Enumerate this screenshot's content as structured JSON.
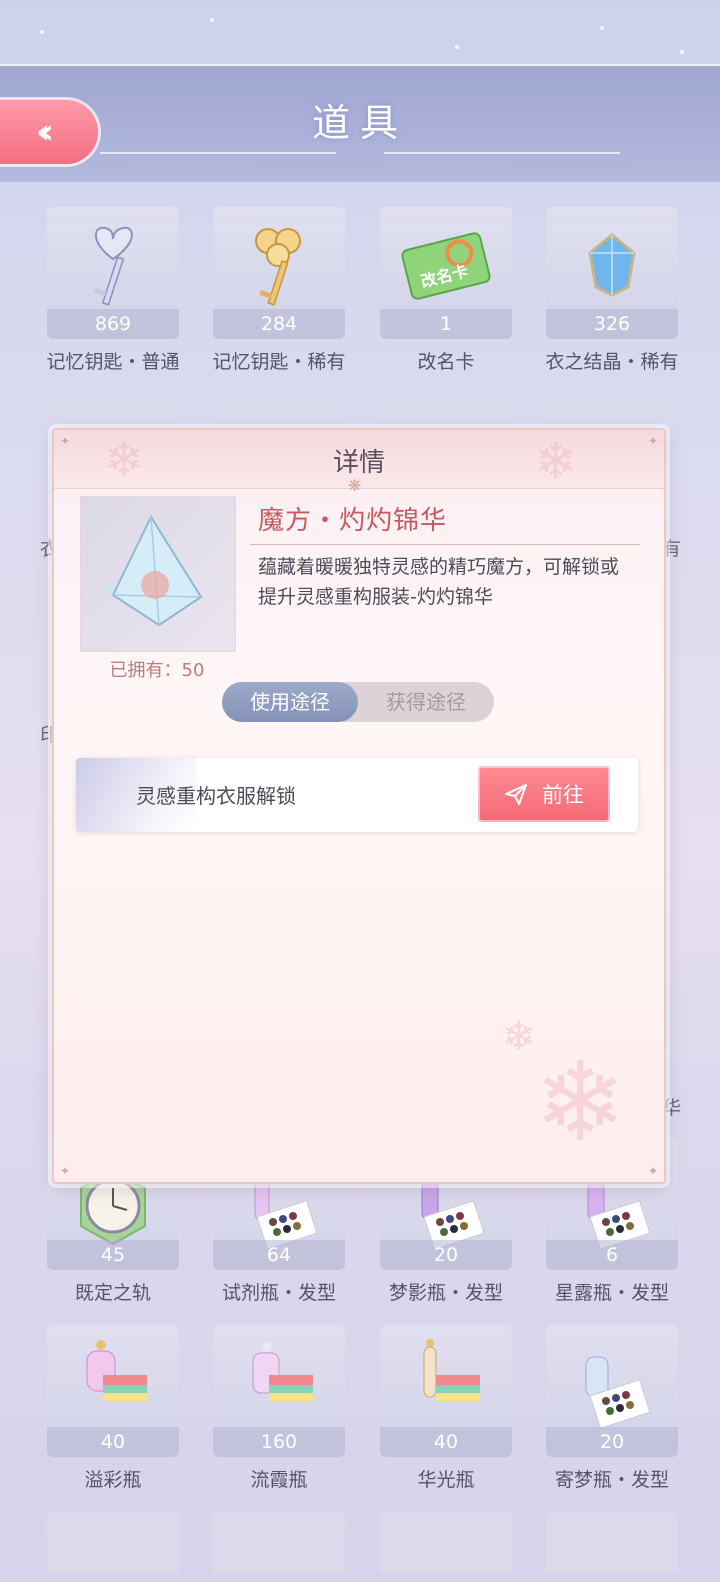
{
  "header": {
    "title": "道具",
    "back_icon": "double-chevron-left-icon"
  },
  "items_top": [
    {
      "count": "869",
      "name": "记忆钥匙・普通",
      "icon": "silver-key-icon"
    },
    {
      "count": "284",
      "name": "记忆钥匙・稀有",
      "icon": "gold-key-icon"
    },
    {
      "count": "1",
      "name": "改名卡",
      "icon": "rename-card-icon",
      "card_text": "改名卡"
    },
    {
      "count": "326",
      "name": "衣之结晶・稀有",
      "icon": "blue-gem-icon"
    }
  ],
  "partial_labels": {
    "left1": "衣",
    "right1": "有",
    "left2": "印",
    "right2": "华"
  },
  "items_bottom1": [
    {
      "count": "45",
      "name": "既定之轨",
      "icon": "clock-icon"
    },
    {
      "count": "64",
      "name": "试剂瓶・发型",
      "icon": "bottle-palette-icon"
    },
    {
      "count": "20",
      "name": "梦影瓶・发型",
      "icon": "bottle-palette-icon"
    },
    {
      "count": "6",
      "name": "星露瓶・发型",
      "icon": "bottle-palette-icon"
    }
  ],
  "items_bottom2": [
    {
      "count": "40",
      "name": "溢彩瓶",
      "icon": "perfume-fabric-icon"
    },
    {
      "count": "160",
      "name": "流霞瓶",
      "icon": "perfume-fabric-icon"
    },
    {
      "count": "40",
      "name": "华光瓶",
      "icon": "perfume-fabric-icon"
    },
    {
      "count": "20",
      "name": "寄梦瓶・发型",
      "icon": "bottle-palette-icon"
    }
  ],
  "modal": {
    "title": "详情",
    "item_name": "魔方・灼灼锦华",
    "description": "蕴藏着暖暖独特灵感的精巧魔方，可解锁或提升灵感重构服装-灼灼锦华",
    "owned": "已拥有：50",
    "tabs": {
      "use": "使用途径",
      "obtain": "获得途径"
    },
    "route": {
      "label": "灵感重构衣服解锁",
      "button": "前往"
    }
  }
}
